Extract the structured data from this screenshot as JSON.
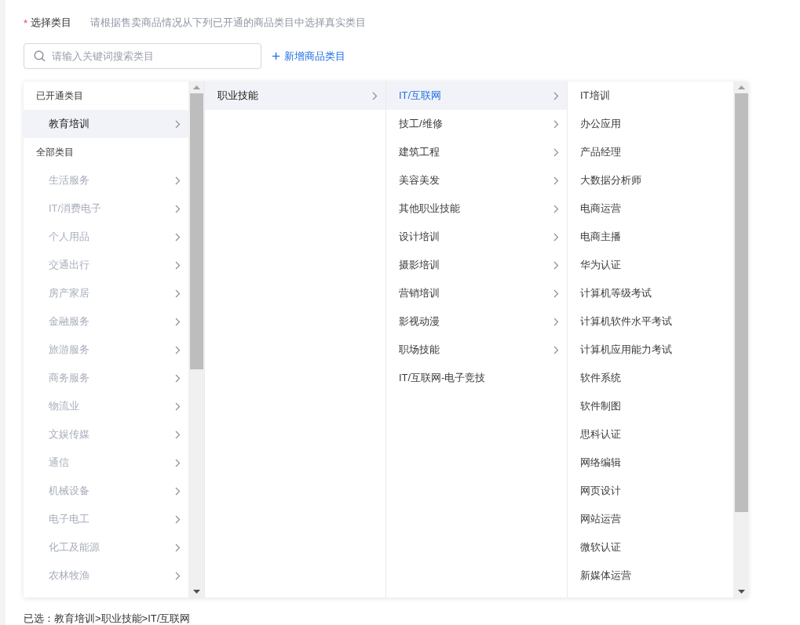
{
  "field": {
    "required_mark": "*",
    "label": "选择类目",
    "hint": "请根据售卖商品情况从下列已开通的商品类目中选择真实类目"
  },
  "search": {
    "placeholder": "请输入关键词搜索类目"
  },
  "add_link": {
    "icon": "+",
    "label": "新增商品类目"
  },
  "columns": [
    {
      "scrollbar": true,
      "items": [
        {
          "kind": "header",
          "label": "已开通类目"
        },
        {
          "kind": "item",
          "label": "教育培训",
          "selected": true,
          "disabled": false,
          "has_children": true
        },
        {
          "kind": "header",
          "label": "全部类目"
        },
        {
          "kind": "item",
          "label": "生活服务",
          "selected": false,
          "disabled": true,
          "has_children": true
        },
        {
          "kind": "item",
          "label": "IT/消费电子",
          "selected": false,
          "disabled": true,
          "has_children": true
        },
        {
          "kind": "item",
          "label": "个人用品",
          "selected": false,
          "disabled": true,
          "has_children": true
        },
        {
          "kind": "item",
          "label": "交通出行",
          "selected": false,
          "disabled": true,
          "has_children": true
        },
        {
          "kind": "item",
          "label": "房产家居",
          "selected": false,
          "disabled": true,
          "has_children": true
        },
        {
          "kind": "item",
          "label": "金融服务",
          "selected": false,
          "disabled": true,
          "has_children": true
        },
        {
          "kind": "item",
          "label": "旅游服务",
          "selected": false,
          "disabled": true,
          "has_children": true
        },
        {
          "kind": "item",
          "label": "商务服务",
          "selected": false,
          "disabled": true,
          "has_children": true
        },
        {
          "kind": "item",
          "label": "物流业",
          "selected": false,
          "disabled": true,
          "has_children": true
        },
        {
          "kind": "item",
          "label": "文娱传媒",
          "selected": false,
          "disabled": true,
          "has_children": true
        },
        {
          "kind": "item",
          "label": "通信",
          "selected": false,
          "disabled": true,
          "has_children": true
        },
        {
          "kind": "item",
          "label": "机械设备",
          "selected": false,
          "disabled": true,
          "has_children": true
        },
        {
          "kind": "item",
          "label": "电子电工",
          "selected": false,
          "disabled": true,
          "has_children": true
        },
        {
          "kind": "item",
          "label": "化工及能源",
          "selected": false,
          "disabled": true,
          "has_children": true
        },
        {
          "kind": "item",
          "label": "农林牧渔",
          "selected": false,
          "disabled": true,
          "has_children": true
        }
      ]
    },
    {
      "items": [
        {
          "kind": "option",
          "label": "职业技能",
          "selected": true,
          "has_children": true
        }
      ]
    },
    {
      "items": [
        {
          "kind": "option",
          "label": "IT/互联网",
          "selected": true,
          "has_children": true
        },
        {
          "kind": "option",
          "label": "技工/维修",
          "selected": false,
          "has_children": true
        },
        {
          "kind": "option",
          "label": "建筑工程",
          "selected": false,
          "has_children": true
        },
        {
          "kind": "option",
          "label": "美容美发",
          "selected": false,
          "has_children": true
        },
        {
          "kind": "option",
          "label": "其他职业技能",
          "selected": false,
          "has_children": true
        },
        {
          "kind": "option",
          "label": "设计培训",
          "selected": false,
          "has_children": true
        },
        {
          "kind": "option",
          "label": "摄影培训",
          "selected": false,
          "has_children": true
        },
        {
          "kind": "option",
          "label": "营销培训",
          "selected": false,
          "has_children": true
        },
        {
          "kind": "option",
          "label": "影视动漫",
          "selected": false,
          "has_children": true
        },
        {
          "kind": "option",
          "label": "职场技能",
          "selected": false,
          "has_children": true
        },
        {
          "kind": "option",
          "label": "IT/互联网-电子竞技",
          "selected": false,
          "has_children": false
        }
      ]
    },
    {
      "scrollbar": true,
      "items": [
        {
          "kind": "option",
          "label": "IT培训",
          "selected": false,
          "has_children": false
        },
        {
          "kind": "option",
          "label": "办公应用",
          "selected": false,
          "has_children": false
        },
        {
          "kind": "option",
          "label": "产品经理",
          "selected": false,
          "has_children": false
        },
        {
          "kind": "option",
          "label": "大数据分析师",
          "selected": false,
          "has_children": false
        },
        {
          "kind": "option",
          "label": "电商运营",
          "selected": false,
          "has_children": false
        },
        {
          "kind": "option",
          "label": "电商主播",
          "selected": false,
          "has_children": false
        },
        {
          "kind": "option",
          "label": "华为认证",
          "selected": false,
          "has_children": false
        },
        {
          "kind": "option",
          "label": "计算机等级考试",
          "selected": false,
          "has_children": false
        },
        {
          "kind": "option",
          "label": "计算机软件水平考试",
          "selected": false,
          "has_children": false
        },
        {
          "kind": "option",
          "label": "计算机应用能力考试",
          "selected": false,
          "has_children": false
        },
        {
          "kind": "option",
          "label": "软件系统",
          "selected": false,
          "has_children": false
        },
        {
          "kind": "option",
          "label": "软件制图",
          "selected": false,
          "has_children": false
        },
        {
          "kind": "option",
          "label": "思科认证",
          "selected": false,
          "has_children": false
        },
        {
          "kind": "option",
          "label": "网络编辑",
          "selected": false,
          "has_children": false
        },
        {
          "kind": "option",
          "label": "网页设计",
          "selected": false,
          "has_children": false
        },
        {
          "kind": "option",
          "label": "网站运营",
          "selected": false,
          "has_children": false
        },
        {
          "kind": "option",
          "label": "微软认证",
          "selected": false,
          "has_children": false
        },
        {
          "kind": "option",
          "label": "新媒体运营",
          "selected": false,
          "has_children": false
        }
      ]
    }
  ],
  "selected_path": "已选：教育培训>职业技能>IT/互联网"
}
